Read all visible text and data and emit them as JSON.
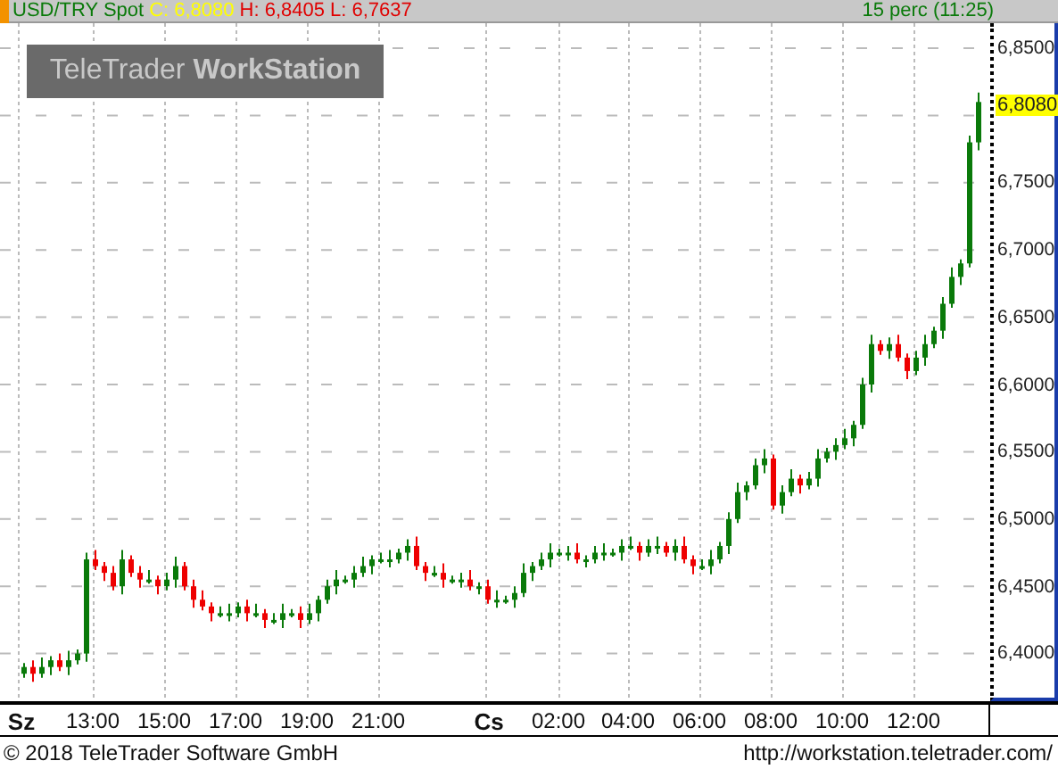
{
  "header": {
    "symbol": "USD/TRY Spot",
    "close": "C: 6,8080",
    "high": "H: 6,8405",
    "low": "L: 6,7637",
    "interval": "15 perc (11:25)"
  },
  "logo": {
    "text": "TeleTrader **WorkStation**"
  },
  "price_axis": {
    "ticks": [
      "6,8500",
      "6,7500",
      "6,7000",
      "6,6500",
      "6,6000",
      "6,5500",
      "6,5000",
      "6,4500",
      "6,4000"
    ],
    "current": "6,8080"
  },
  "time_axis": [
    {
      "label": "Sz",
      "kind": "day"
    },
    {
      "label": "13:00",
      "kind": "time"
    },
    {
      "label": "15:00",
      "kind": "time"
    },
    {
      "label": "17:00",
      "kind": "time"
    },
    {
      "label": "19:00",
      "kind": "time"
    },
    {
      "label": "21:00",
      "kind": "time"
    },
    {
      "label": "Cs",
      "kind": "day"
    },
    {
      "label": "02:00",
      "kind": "time"
    },
    {
      "label": "04:00",
      "kind": "time"
    },
    {
      "label": "06:00",
      "kind": "time"
    },
    {
      "label": "08:00",
      "kind": "time"
    },
    {
      "label": "10:00",
      "kind": "time"
    },
    {
      "label": "12:00",
      "kind": "time"
    }
  ],
  "footer": {
    "copyright": "© 2018 TeleTrader Software GmbH",
    "url": "http://workstation.teletrader.com/"
  }
}
